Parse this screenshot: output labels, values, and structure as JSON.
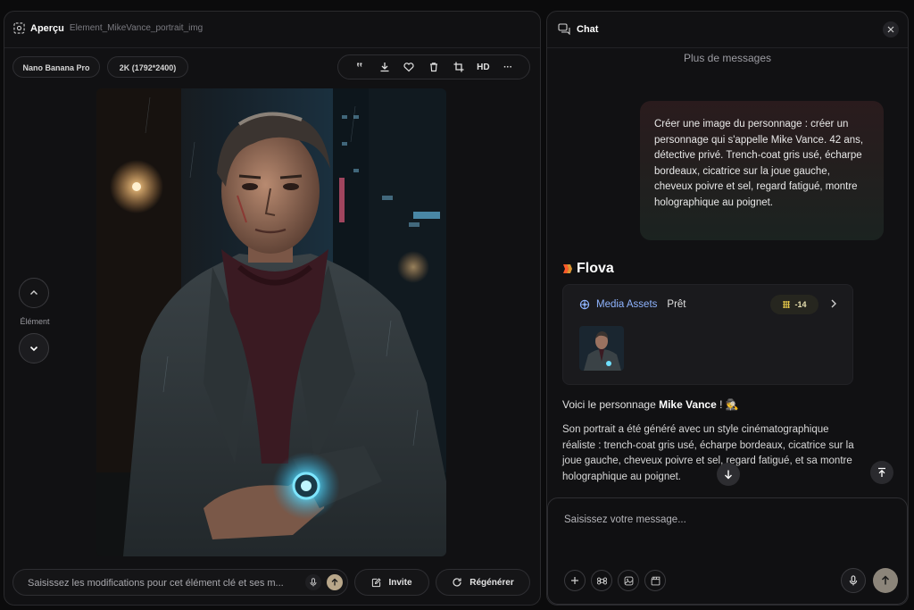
{
  "preview": {
    "title": "Aperçu",
    "filename": "Element_MikeVance_portrait_img",
    "chips": [
      "Nano Banana Pro",
      "2K (1792*2400)"
    ],
    "toolbar": {
      "hd_label": "HD",
      "more_label": "···",
      "quote_label": "‟"
    },
    "nav_label": "Élément",
    "edit_placeholder": "Saisissez les modifications pour cet élément clé et ses m...",
    "invite_label": "Invite",
    "regenerate_label": "Régénérer"
  },
  "chat": {
    "title": "Chat",
    "more_messages": "Plus de messages",
    "user_message": "Créer une image du personnage : créer un personnage qui s'appelle Mike Vance. 42 ans, détective privé. Trench-coat gris usé, écharpe bordeaux, cicatrice sur la joue gauche, cheveux poivre et sel, regard fatigué, montre holographique au poignet.",
    "bot_name": "Flova",
    "asset_card": {
      "title": "Media Assets",
      "status": "Prêt",
      "credits": "-14"
    },
    "reply_prefix": "Voici le personnage ",
    "reply_name": "Mike Vance",
    "reply_suffix": " ! 🕵",
    "reply_body": "Son portrait a été généré avec un style cinématographique réaliste : trench-coat gris usé, écharpe bordeaux, cicatrice sur la joue gauche, cheveux poivre et sel, regard fatigué, et sa montre holographique au poignet.",
    "composer_placeholder": "Saisissez votre message..."
  },
  "colors": {
    "accent_link": "#8fb4ff",
    "watch_glow": "#4fd8ff",
    "flova_logo": "#ff5a2a"
  }
}
